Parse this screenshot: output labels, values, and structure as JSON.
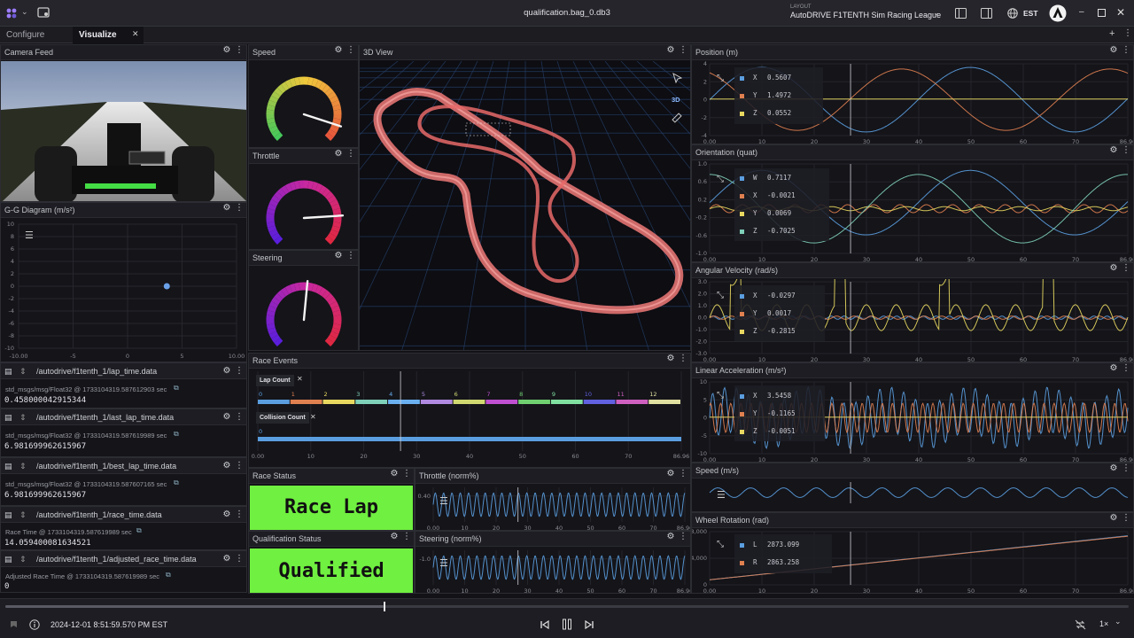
{
  "app": {
    "title": "qualification.bag_0.db3",
    "layout_caption": "LAYOUT",
    "layout_name": "AutoDRIVE F1TENTH Sim Racing League",
    "timezone": "EST"
  },
  "tabs": [
    {
      "label": "Configure"
    },
    {
      "label": "Visualize"
    }
  ],
  "panels": {
    "camera": {
      "title": "Camera Feed"
    },
    "gg": {
      "title": "G-G Diagram (m/s²)",
      "yticks": [
        "10",
        "8",
        "6",
        "4",
        "2",
        "0",
        "-2",
        "-4",
        "-6",
        "-8",
        "-10"
      ],
      "xticks": [
        "-10.00",
        "-5",
        "0",
        "5",
        "10.00"
      ],
      "point": {
        "x": 3.6,
        "y": 0
      }
    },
    "speed": {
      "title": "Speed",
      "value": 0.9
    },
    "throttle": {
      "title": "Throttle",
      "value": 0.82
    },
    "steering": {
      "title": "Steering",
      "value": 0.52
    },
    "view3d": {
      "title": "3D View",
      "mode": "3D"
    },
    "position": {
      "title": "Position (m)",
      "legend": [
        {
          "name": "X",
          "value": "0.5607",
          "color": "#5b9ee0"
        },
        {
          "name": "Y",
          "value": "1.4972",
          "color": "#e08050"
        },
        {
          "name": "Z",
          "value": "0.0552",
          "color": "#e8d860"
        }
      ],
      "yticks": [
        "4",
        "2",
        "0",
        "-2",
        "-4"
      ],
      "xticks": [
        "0.00",
        "10",
        "20",
        "30",
        "40",
        "50",
        "60",
        "70",
        "86.96"
      ]
    },
    "orientation": {
      "title": "Orientation (quat)",
      "legend": [
        {
          "name": "W",
          "value": "0.7117",
          "color": "#5b9ee0"
        },
        {
          "name": "X",
          "value": "-0.0021",
          "color": "#e08050"
        },
        {
          "name": "Y",
          "value": "0.0069",
          "color": "#e8d860"
        },
        {
          "name": "Z",
          "value": "-0.7025",
          "color": "#7fd0b8"
        }
      ],
      "yticks": [
        "1.0",
        "0.6",
        "0.2",
        "-0.2",
        "-0.6",
        "-1.0"
      ],
      "xticks": [
        "0.00",
        "10",
        "20",
        "30",
        "40",
        "50",
        "60",
        "70",
        "86.96"
      ]
    },
    "angvel": {
      "title": "Angular Velocity (rad/s)",
      "legend": [
        {
          "name": "X",
          "value": "-0.0297",
          "color": "#5b9ee0"
        },
        {
          "name": "Y",
          "value": "0.0017",
          "color": "#e08050"
        },
        {
          "name": "Z",
          "value": "-0.2815",
          "color": "#e8d860"
        }
      ],
      "yticks": [
        "3.0",
        "2.0",
        "1.0",
        "0.0",
        "-1.0",
        "-2.0",
        "-3.0"
      ],
      "xticks": [
        "0.00",
        "10",
        "20",
        "30",
        "40",
        "50",
        "60",
        "70",
        "86.96"
      ]
    },
    "linacc": {
      "title": "Linear Acceleration (m/s²)",
      "legend": [
        {
          "name": "X",
          "value": "3.5458",
          "color": "#5b9ee0"
        },
        {
          "name": "Y",
          "value": "-0.1165",
          "color": "#e08050"
        },
        {
          "name": "Z",
          "value": "-0.0051",
          "color": "#e8d860"
        }
      ],
      "yticks": [
        "10",
        "5",
        "0",
        "-5",
        "-10"
      ],
      "xticks": [
        "0.00",
        "10",
        "20",
        "30",
        "40",
        "50",
        "60",
        "70",
        "86.96"
      ]
    },
    "speedplot": {
      "title": "Speed (m/s)"
    },
    "wheel": {
      "title": "Wheel Rotation (rad)",
      "legend": [
        {
          "name": "L",
          "value": "2873.099",
          "color": "#5b9ee0"
        },
        {
          "name": "R",
          "value": "2863.258",
          "color": "#e08050"
        }
      ],
      "yticks": [
        "8,000",
        "4,000",
        "0"
      ],
      "xticks": [
        "0.00",
        "10",
        "20",
        "30",
        "40",
        "50",
        "60",
        "70",
        "86.96"
      ]
    },
    "race_events": {
      "title": "Race Events",
      "lap_label": "Lap Count",
      "collision_label": "Collision Count",
      "lap_numbers": [
        "0",
        "1",
        "2",
        "3",
        "4",
        "5",
        "6",
        "7",
        "8",
        "9",
        "10",
        "11",
        "12"
      ],
      "collision_numbers": [
        "0"
      ],
      "xticks": [
        "0.00",
        "10",
        "20",
        "30",
        "40",
        "50",
        "60",
        "70",
        "86.96"
      ]
    },
    "race_status": {
      "title": "Race Status",
      "value": "Race Lap"
    },
    "qual_status": {
      "title": "Qualification Status",
      "value": "Qualified"
    },
    "throttle_plot": {
      "title": "Throttle (norm%)",
      "yticks": [
        "0.40"
      ],
      "xticks": [
        "0.00",
        "10",
        "20",
        "30",
        "40",
        "50",
        "60",
        "70",
        "86.96"
      ]
    },
    "steering_plot": {
      "title": "Steering (norm%)",
      "yticks": [
        "-1.0"
      ],
      "xticks": [
        "0.00",
        "10",
        "20",
        "30",
        "40",
        "50",
        "60",
        "70",
        "86.96"
      ]
    }
  },
  "raw_messages": [
    {
      "topic": "/autodrive/f1tenth_1/lap_time.data",
      "meta": "std_msgs/msg/Float32 @ 1733104319.587612903 sec",
      "value": "0.458000042915344"
    },
    {
      "topic": "/autodrive/f1tenth_1/last_lap_time.data",
      "meta": "std_msgs/msg/Float32 @ 1733104319.587619989 sec",
      "value": "6.981699962615967"
    },
    {
      "topic": "/autodrive/f1tenth_1/best_lap_time.data",
      "meta": "std_msgs/msg/Float32 @ 1733104319.587607165 sec",
      "value": "6.981699962615967"
    },
    {
      "topic": "/autodrive/f1tenth_1/race_time.data",
      "meta": "Race Time @ 1733104319.587619989 sec",
      "value": "14.059400081634521"
    },
    {
      "topic": "/autodrive/f1tenth_1/adjusted_race_time.data",
      "meta": "Adjusted Race Time @ 1733104319.587619989 sec",
      "value": "0"
    }
  ],
  "playback": {
    "timestamp": "2024-12-01 8:51:59.570 PM EST",
    "speed": "1×",
    "progress": 0.337
  },
  "colors": {
    "accent": "#5b9ee0",
    "status_green": "#70f040",
    "track": "#f07a78"
  }
}
